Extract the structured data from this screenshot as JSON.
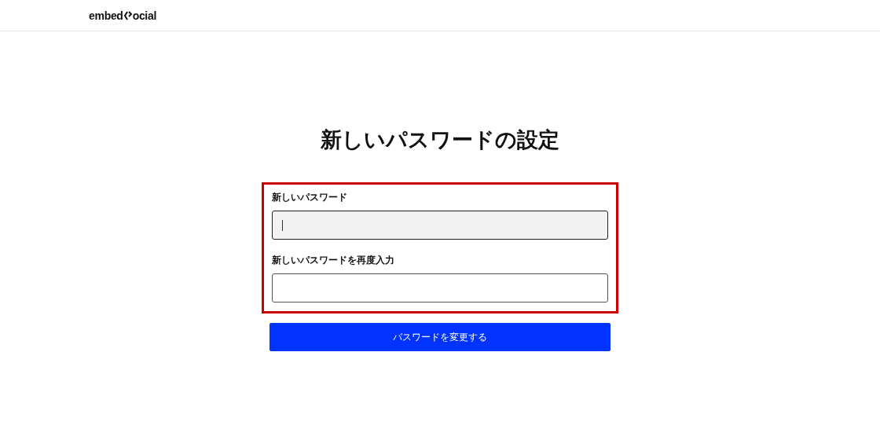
{
  "header": {
    "logo": {
      "before": "embed",
      "after": "ocial"
    }
  },
  "title": "新しいパスワードの設定",
  "form": {
    "highlighted": true,
    "fields": [
      {
        "label": "新しいパスワード",
        "focused": true
      },
      {
        "label": "新しいパスワードを再度入力",
        "focused": false
      }
    ]
  },
  "submit_button": {
    "label": "パスワードを変更する"
  }
}
